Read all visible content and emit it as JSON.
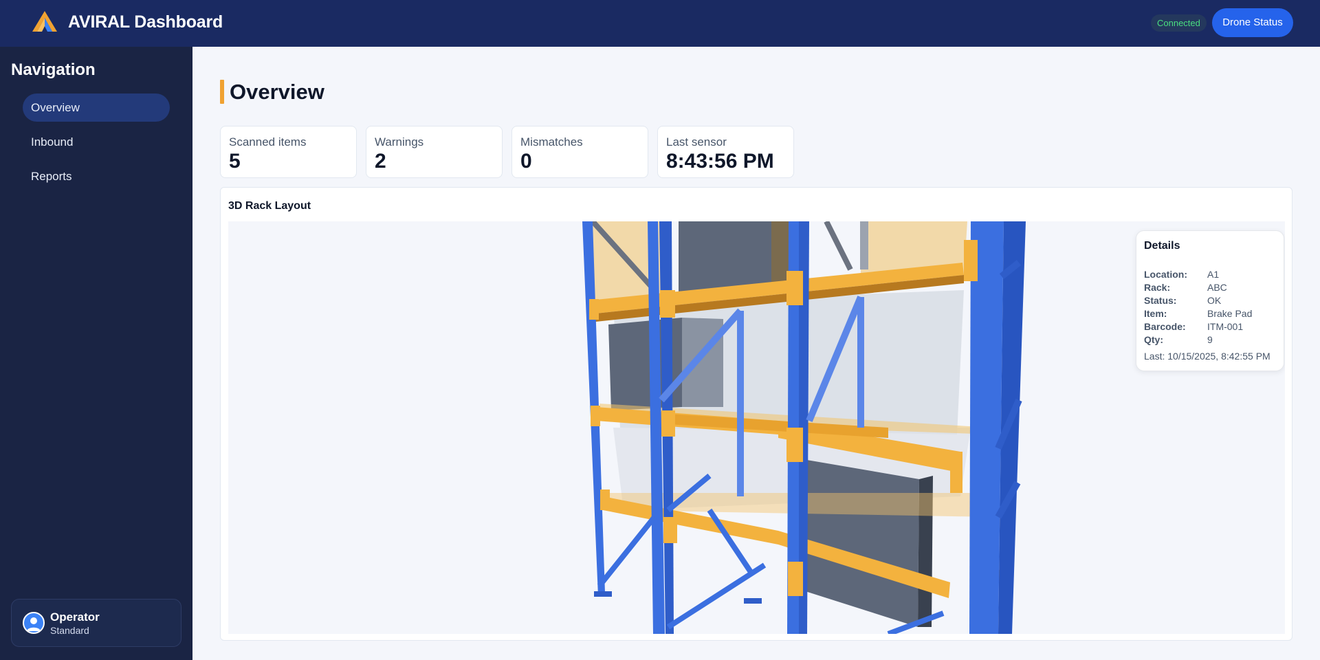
{
  "header": {
    "title": "AVIRAL Dashboard",
    "connection_status": "Connected",
    "drone_status_label": "Drone Status"
  },
  "sidebar": {
    "title": "Navigation",
    "items": [
      {
        "label": "Overview",
        "active": true
      },
      {
        "label": "Inbound",
        "active": false
      },
      {
        "label": "Reports",
        "active": false
      }
    ],
    "user": {
      "name": "Operator",
      "role": "Standard"
    }
  },
  "main": {
    "title": "Overview",
    "stats": [
      {
        "label": "Scanned items",
        "value": "5"
      },
      {
        "label": "Warnings",
        "value": "2"
      },
      {
        "label": "Mismatches",
        "value": "0"
      },
      {
        "label": "Last sensor",
        "value": "8:43:56 PM"
      }
    ],
    "layout_panel": {
      "title": "3D Rack Layout"
    },
    "details": {
      "title": "Details",
      "rows": [
        {
          "key": "Location:",
          "value": "A1"
        },
        {
          "key": "Rack:",
          "value": "ABC"
        },
        {
          "key": "Status:",
          "value": "OK"
        },
        {
          "key": "Item:",
          "value": "Brake Pad"
        },
        {
          "key": "Barcode:",
          "value": "ITM-001"
        },
        {
          "key": "Qty:",
          "value": "9"
        }
      ],
      "last": "Last: 10/15/2025, 8:42:55 PM"
    }
  },
  "colors": {
    "header_bg": "#1a2a62",
    "sidebar_bg": "#1a2444",
    "accent_blue": "#2563eb",
    "accent_orange": "#f0a232",
    "rack_upright": "#3b6fe0",
    "rack_beam": "#f3b23e",
    "box": "#5a6577",
    "connected": "#4ade80"
  },
  "icons": {
    "logo": "aviral-logo-icon",
    "user": "user-icon"
  }
}
